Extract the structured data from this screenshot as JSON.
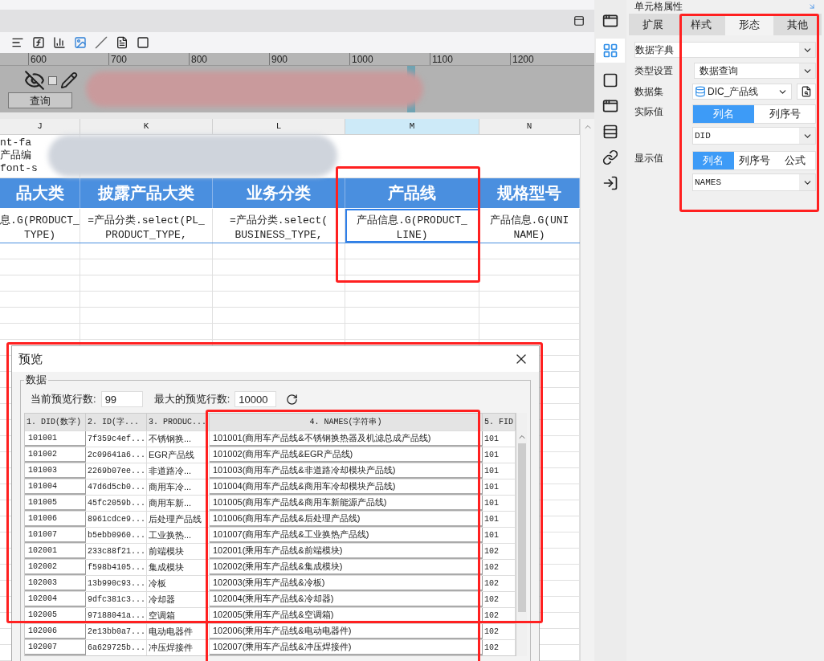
{
  "ruler": {
    "marks": [
      "600",
      "700",
      "800",
      "900",
      "1000",
      "1100",
      "1200"
    ]
  },
  "form_preview": {
    "query_button": "查询",
    "checkbox": {
      "checked": false
    }
  },
  "sheet": {
    "columns": [
      {
        "label": "J",
        "selected": false
      },
      {
        "label": "K",
        "selected": false
      },
      {
        "label": "L",
        "selected": false
      },
      {
        "label": "M",
        "selected": true
      },
      {
        "label": "N",
        "selected": false
      }
    ],
    "text_row": [
      "nt-fa",
      "产品编",
      "font-s"
    ],
    "header_row": [
      "品大类",
      "披露产品大类",
      "业务分类",
      "产品线",
      "规格型号"
    ],
    "formula_row": [
      {
        "lines": [
          "息.G(PRODUCT_",
          "TYPE)"
        ],
        "selected": false
      },
      {
        "lines": [
          "=产品分类.select(PL_",
          "PRODUCT_TYPE,"
        ],
        "selected": false
      },
      {
        "lines": [
          "=产品分类.select(",
          "BUSINESS_TYPE,"
        ],
        "selected": false
      },
      {
        "lines": [
          "产品信息.G(PRODUCT_",
          "LINE)"
        ],
        "selected": true
      },
      {
        "lines": [
          "产品信息.G(UNI",
          "NAME)"
        ],
        "selected": false
      }
    ]
  },
  "properties": {
    "title": "单元格属性",
    "tabs": [
      {
        "label": "扩展",
        "selected": false
      },
      {
        "label": "样式",
        "selected": false
      },
      {
        "label": "形态",
        "selected": true
      },
      {
        "label": "其他",
        "selected": false
      }
    ],
    "data_dictionary": "数据字典",
    "type_label": "类型设置",
    "type_value": "数据查询",
    "dataset_label": "数据集",
    "dataset_value": "DIC_产品线",
    "actual_label": "实际值",
    "actual_modes": [
      {
        "label": "列名",
        "selected": true
      },
      {
        "label": "列序号",
        "selected": false
      }
    ],
    "actual_value": "DID",
    "display_label": "显示值",
    "display_modes": [
      {
        "label": "列名",
        "selected": true
      },
      {
        "label": "列序号",
        "selected": false
      },
      {
        "label": "公式",
        "selected": false
      }
    ],
    "display_value": "NAMES"
  },
  "preview": {
    "title": "预览",
    "group": "数据",
    "current_rows_label": "当前预览行数:",
    "current_rows": "99",
    "max_rows_label": "最大的预览行数:",
    "max_rows": "10000",
    "columns": [
      "1. DID(数字)",
      "2. ID(字...",
      "3. PRODUC...",
      "4. NAMES(字符串)",
      "5. FID"
    ],
    "rows": [
      [
        "101001",
        "7f359c4ef...",
        "不锈钢换...",
        "101001(商用车产品线&不锈钢换热器及机滤总成产品线)",
        "101"
      ],
      [
        "101002",
        "2c09641a6...",
        "EGR产品线",
        "101002(商用车产品线&EGR产品线)",
        "101"
      ],
      [
        "101003",
        "2269b07ee...",
        "非道路冷...",
        "101003(商用车产品线&非道路冷却模块产品线)",
        "101"
      ],
      [
        "101004",
        "47d6d5cb0...",
        "商用车冷...",
        "101004(商用车产品线&商用车冷却模块产品线)",
        "101"
      ],
      [
        "101005",
        "45fc2059b...",
        "商用车新...",
        "101005(商用车产品线&商用车新能源产品线)",
        "101"
      ],
      [
        "101006",
        "8961cdce9...",
        "后处理产品线",
        "101006(商用车产品线&后处理产品线)",
        "101"
      ],
      [
        "101007",
        "b5ebb0960...",
        "工业换热...",
        "101007(商用车产品线&工业换热产品线)",
        "101"
      ],
      [
        "102001",
        "233c88f21...",
        "前端模块",
        "102001(乘用车产品线&前端模块)",
        "102"
      ],
      [
        "102002",
        "f598b4105...",
        "集成模块",
        "102002(乘用车产品线&集成模块)",
        "102"
      ],
      [
        "102003",
        "13b990c93...",
        "冷板",
        "102003(乘用车产品线&冷板)",
        "102"
      ],
      [
        "102004",
        "9dfc381c3...",
        "冷却器",
        "102004(乘用车产品线&冷却器)",
        "102"
      ],
      [
        "102005",
        "97188041a...",
        "空调箱",
        "102005(乘用车产品线&空调箱)",
        "102"
      ],
      [
        "102006",
        "2e13bb0a7...",
        "电动电器件",
        "102006(乘用车产品线&电动电器件)",
        "102"
      ],
      [
        "102007",
        "6a629725b...",
        "冲压焊接件",
        "102007(乘用车产品线&冲压焊接件)",
        "102"
      ]
    ]
  }
}
